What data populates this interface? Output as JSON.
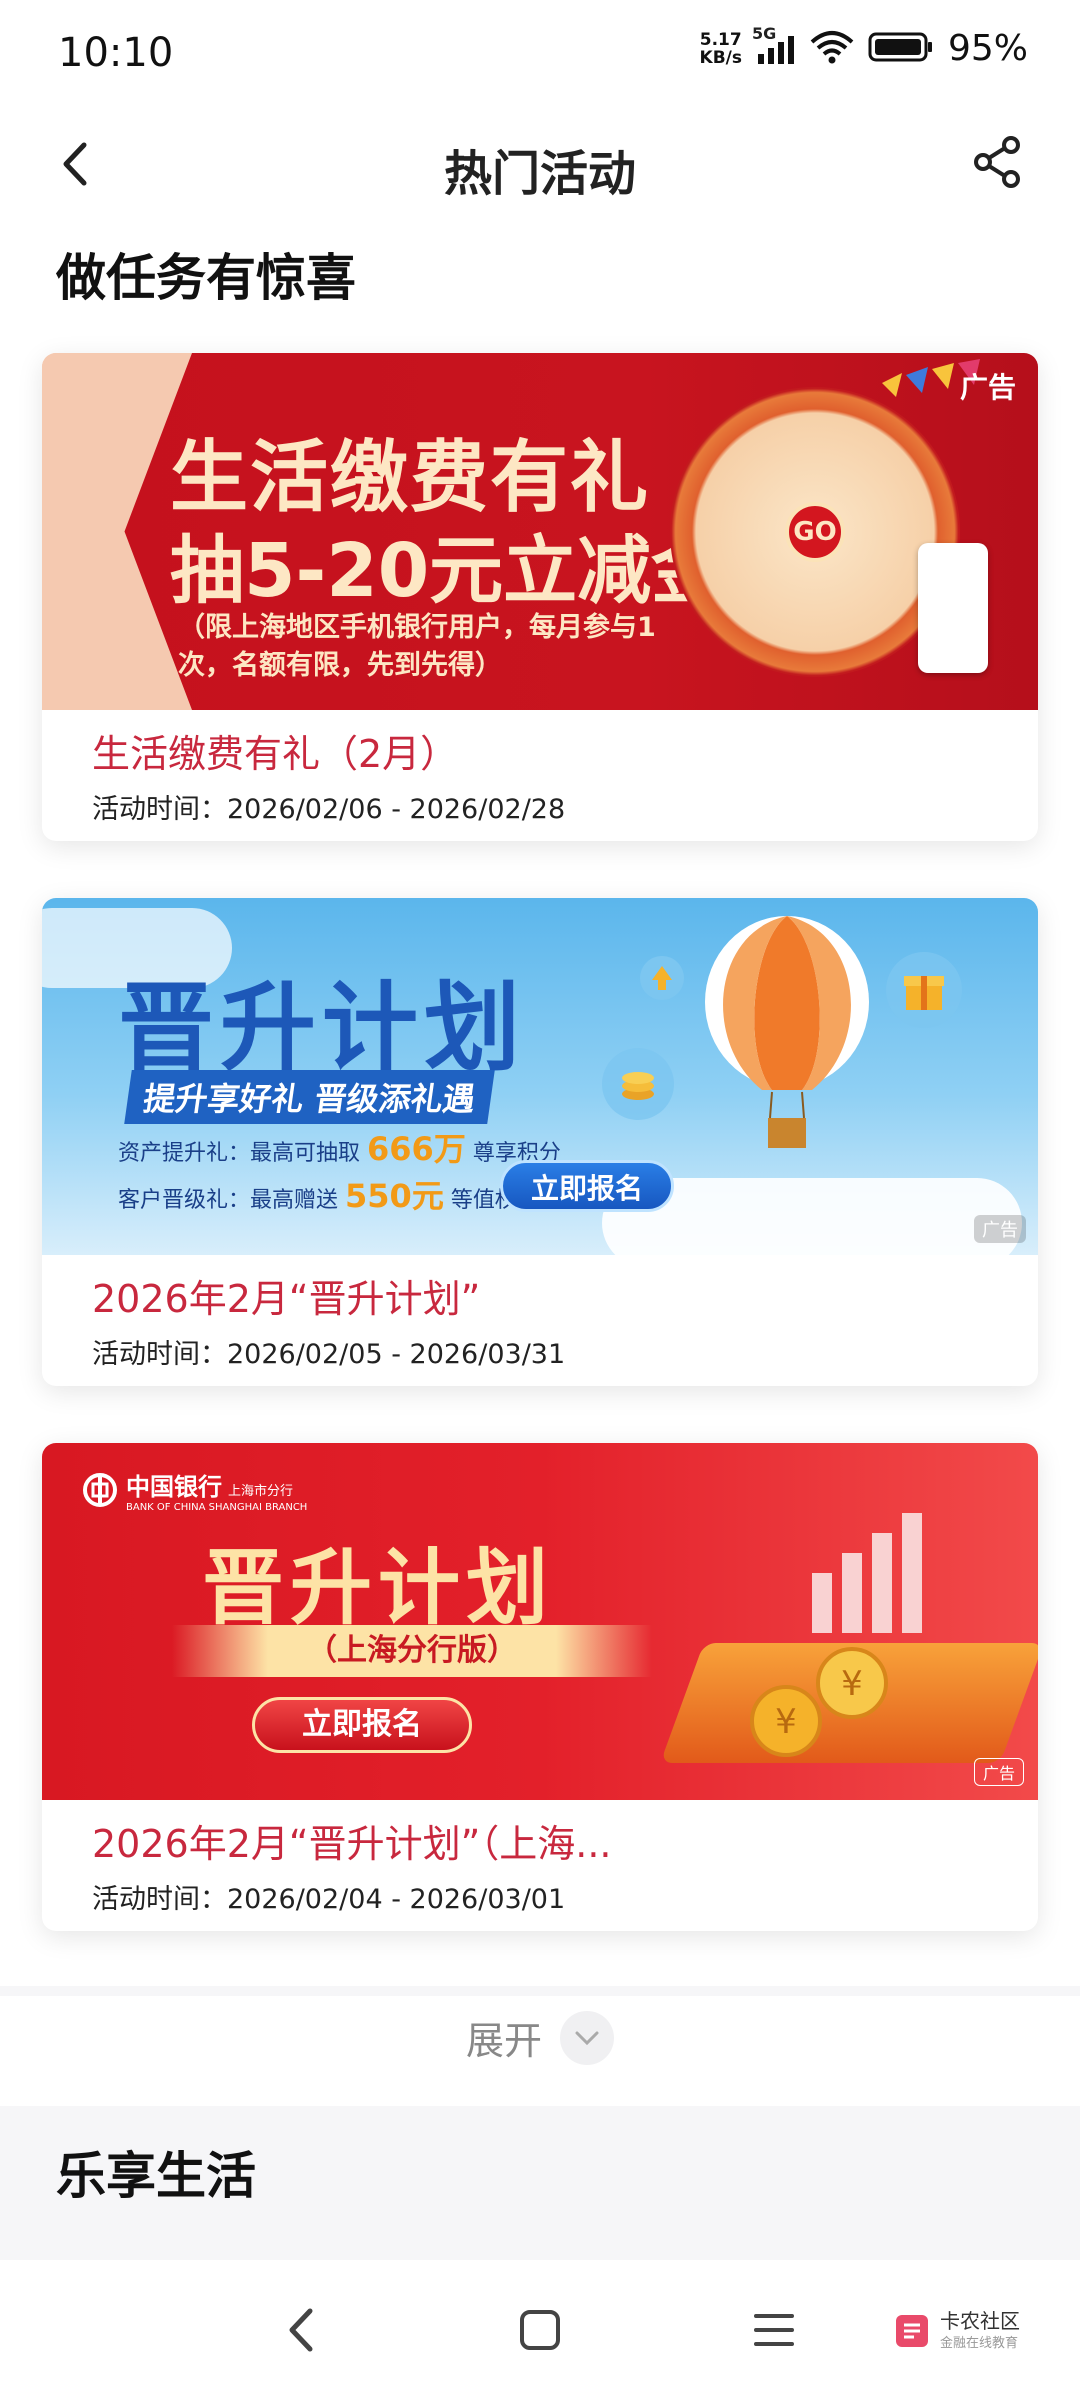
{
  "status_bar": {
    "time": "10:10",
    "speed_value": "5.17",
    "speed_unit": "KB/s",
    "network": "5G",
    "battery_pct": "95%",
    "battery_level": 0.95
  },
  "header": {
    "title": "热门活动",
    "back_icon": "chevron-left-icon",
    "share_icon": "share-icon"
  },
  "sections": {
    "tasks_title": "做任务有惊喜",
    "life_title": "乐享生活"
  },
  "cards": [
    {
      "name": "生活缴费有礼（2月）",
      "time": "活动时间：2026/02/06 - 2026/02/28",
      "ad_label": "广告",
      "banner": {
        "line1": "生活缴费有礼",
        "line2": "抽5-20元立减金",
        "note": "（限上海地区手机银行用户，每月参与1次，名额有限，先到先得）",
        "wheel_label": "GO",
        "colors": {
          "bg": "#c8141f",
          "text": "#fde7c4"
        }
      }
    },
    {
      "name": "2026年2月“晋升计划”",
      "time": "活动时间：2026/02/05 - 2026/03/31",
      "ad_label": "广告",
      "banner": {
        "title": "晋升计划",
        "slogan": "提升享好礼 晋级添礼遇",
        "row1_label": "资产提升礼：最高可抽取",
        "row1_value": "666万",
        "row1_suffix": "尊享积分",
        "row2_label": "客户晋级礼：最高赠送",
        "row2_value": "550元",
        "row2_suffix": "等值权益",
        "cta": "立即报名",
        "colors": {
          "bg": "#5bb6ec",
          "title": "#1d58b8"
        }
      }
    },
    {
      "name": "2026年2月“晋升计划”（上海...",
      "time": "活动时间：2026/02/04 - 2026/03/01",
      "ad_label": "广告",
      "banner": {
        "bank_name": "中国银行",
        "bank_branch": "上海市分行",
        "bank_en": "BANK OF CHINA  SHANGHAI BRANCH",
        "title": "晋升计划",
        "subtitle": "（上海分行版）",
        "cta": "立即报名",
        "colors": {
          "bg": "#e3202a",
          "title": "#fde3a6"
        }
      }
    }
  ],
  "expand": {
    "label": "展开",
    "icon": "chevron-down-icon"
  },
  "nav": {
    "back_icon": "nav-back-icon",
    "home_icon": "nav-home-icon",
    "menu_icon": "nav-menu-icon"
  },
  "watermark": {
    "title": "卡农社区",
    "subtitle": "金融在线教育"
  },
  "colors": {
    "accent": "#c8283e",
    "page_bg": "#ffffff"
  }
}
